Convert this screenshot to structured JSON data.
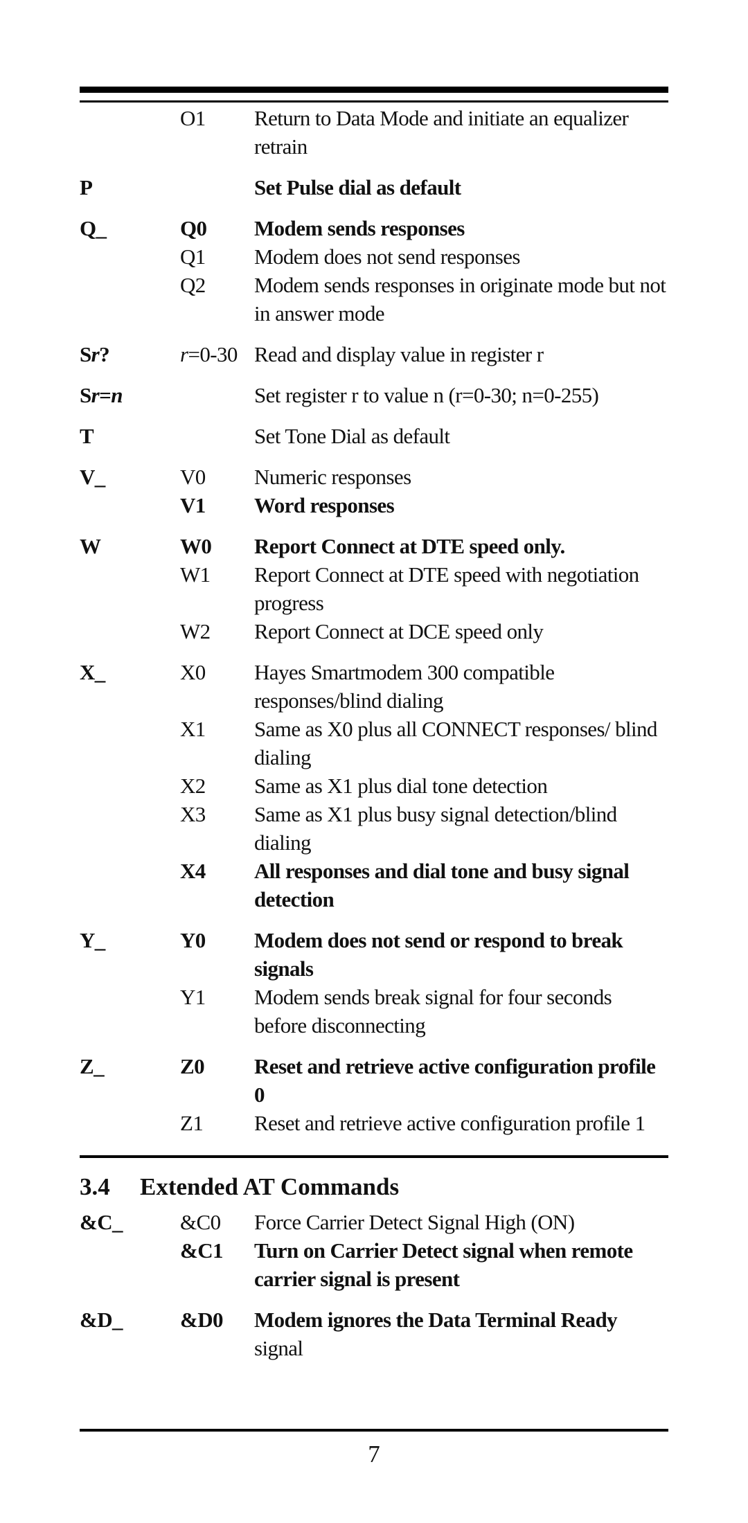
{
  "commands_top": [
    {
      "cmd": "",
      "rows": [
        {
          "opt": "O1",
          "desc": "Return to Data Mode and initiate an equalizer retrain",
          "bold": false
        }
      ]
    },
    {
      "cmd": "P",
      "rows": [
        {
          "opt": "",
          "desc": "Set Pulse dial as default",
          "bold": true
        }
      ]
    },
    {
      "cmd": "Q_",
      "rows": [
        {
          "opt": "Q0",
          "desc": "Modem sends responses",
          "bold": true
        },
        {
          "opt": "Q1",
          "desc": "Modem does not send responses",
          "bold": false
        },
        {
          "opt": "Q2",
          "desc": "Modem sends responses in originate mode but not in answer mode",
          "bold": false
        }
      ]
    },
    {
      "cmd": "Sr?",
      "rows": [
        {
          "opt": "r=0-30",
          "desc": "Read and display value in register r",
          "bold": false
        }
      ]
    },
    {
      "cmd": "Sr=n",
      "rows": [
        {
          "opt": "",
          "desc": "Set register r to value n (r=0-30; n=0-255)",
          "bold": false
        }
      ]
    },
    {
      "cmd": "T",
      "rows": [
        {
          "opt": "",
          "desc": "Set Tone Dial as default",
          "bold": false
        }
      ]
    },
    {
      "cmd": "V_",
      "rows": [
        {
          "opt": "V0",
          "desc": "Numeric responses",
          "bold": false
        },
        {
          "opt": "V1",
          "desc": "Word responses",
          "bold": true
        }
      ]
    },
    {
      "cmd": "W",
      "rows": [
        {
          "opt": "W0",
          "desc": "Report Connect at DTE speed only.",
          "bold": true
        },
        {
          "opt": "W1",
          "desc": "Report Connect at DTE speed with negotiation progress",
          "bold": false
        },
        {
          "opt": "W2",
          "desc": "Report Connect at DCE speed only",
          "bold": false
        }
      ]
    },
    {
      "cmd": "X_",
      "rows": [
        {
          "opt": "X0",
          "desc": "Hayes Smartmodem 300 compatible responses/blind dialing",
          "bold": false
        },
        {
          "opt": "X1",
          "desc": "Same as X0 plus all CONNECT responses/ blind dialing",
          "bold": false
        },
        {
          "opt": "X2",
          "desc": "Same as X1 plus dial tone detection",
          "bold": false
        },
        {
          "opt": "X3",
          "desc": "Same as X1 plus busy signal detection/blind dialing",
          "bold": false
        },
        {
          "opt": "X4",
          "desc": "All responses and dial tone and busy signal detection",
          "bold": true
        }
      ]
    },
    {
      "cmd": "Y_",
      "rows": [
        {
          "opt": "Y0",
          "desc": "Modem does not send or respond to break signals",
          "bold": true
        },
        {
          "opt": "Y1",
          "desc": "Modem sends break signal for four seconds before disconnecting",
          "bold": false
        }
      ]
    },
    {
      "cmd": "Z_",
      "rows": [
        {
          "opt": "Z0",
          "desc": "Reset and retrieve active configuration profile 0",
          "bold": true
        },
        {
          "opt": "Z1",
          "desc": "Reset and retrieve active configuration profile 1",
          "bold": false
        }
      ]
    }
  ],
  "section": {
    "number": "3.4",
    "title": "Extended AT Commands"
  },
  "commands_extended": [
    {
      "cmd": "&C_",
      "rows": [
        {
          "opt": "&C0",
          "desc": "Force Carrier Detect Signal High (ON)",
          "bold": false
        },
        {
          "opt": "&C1",
          "desc": "Turn on Carrier Detect signal when remote carrier signal is present",
          "bold": true
        }
      ]
    },
    {
      "cmd": "&D_",
      "rows": [
        {
          "opt": "&D0",
          "desc_bold": "Modem ignores the Data Terminal Ready",
          "desc_rest": "signal",
          "bold": true
        }
      ]
    }
  ],
  "page_number": "7"
}
